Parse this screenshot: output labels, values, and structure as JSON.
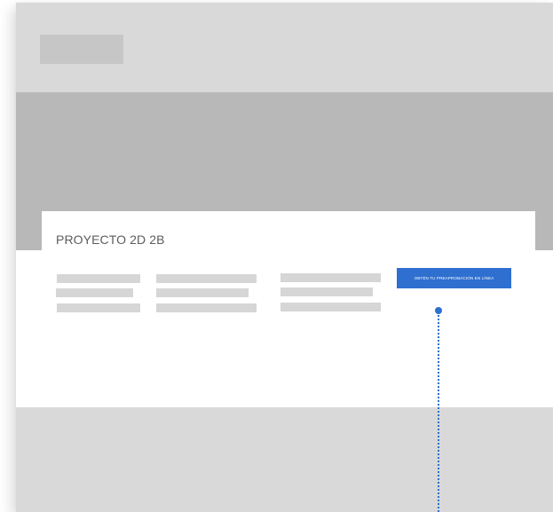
{
  "card": {
    "title": "PROYECTO 2D 2B",
    "cta_label": "OBTÉN TU PREAPROBACIÓN EN LÍNEA"
  },
  "colors": {
    "accent": "#2e6fd0",
    "placeholder": "#d6d6d6",
    "hero": "#b8b8b8",
    "frame": "#d9d9d9"
  }
}
